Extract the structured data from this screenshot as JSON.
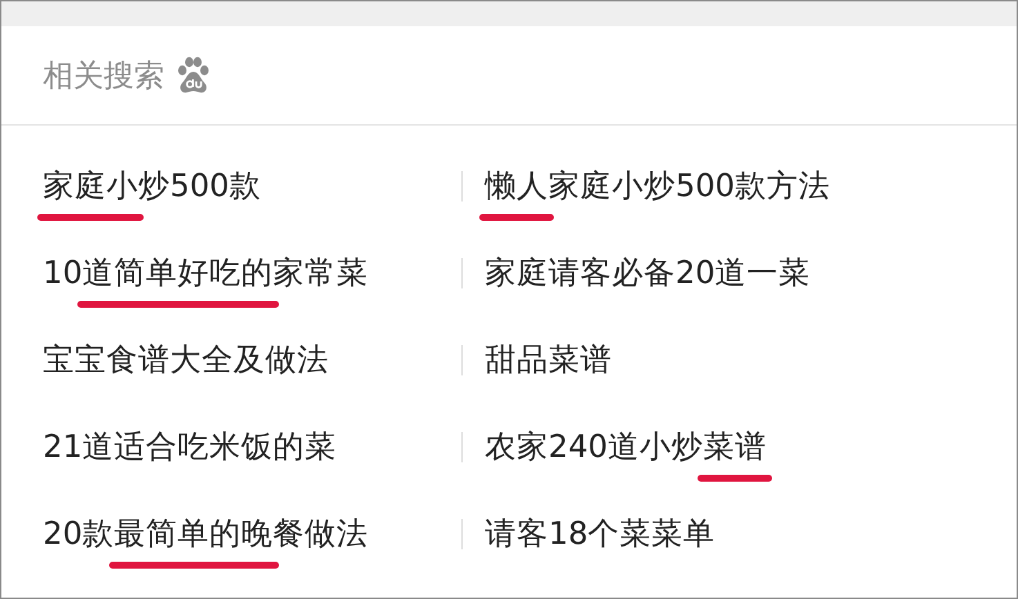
{
  "title": "相关搜索",
  "rows": [
    {
      "left": [
        {
          "text": "家庭小",
          "underlined": true
        },
        {
          "text": "炒500款",
          "underlined": false
        }
      ],
      "right": [
        {
          "text": "懒人",
          "underlined": true
        },
        {
          "text": "家庭小炒500款方法",
          "underlined": false
        }
      ]
    },
    {
      "left": [
        {
          "text": "10",
          "underlined": false
        },
        {
          "text": "道简单好吃的",
          "underlined": true
        },
        {
          "text": "家常菜",
          "underlined": false
        }
      ],
      "right": [
        {
          "text": "家庭请客必备20道一菜",
          "underlined": false
        }
      ]
    },
    {
      "left": [
        {
          "text": "宝宝食谱大全及做法",
          "underlined": false
        }
      ],
      "right": [
        {
          "text": "甜品菜谱",
          "underlined": false
        }
      ]
    },
    {
      "left": [
        {
          "text": "21道适合吃米饭的菜",
          "underlined": false
        }
      ],
      "right": [
        {
          "text": "农家240道小炒",
          "underlined": false
        },
        {
          "text": "菜谱",
          "underlined": true
        }
      ]
    },
    {
      "left": [
        {
          "text": "20款",
          "underlined": false
        },
        {
          "text": "最简单的晚",
          "underlined": true
        },
        {
          "text": "餐做法",
          "underlined": false
        }
      ],
      "right": [
        {
          "text": "请客18个菜菜单",
          "underlined": false
        }
      ]
    }
  ]
}
